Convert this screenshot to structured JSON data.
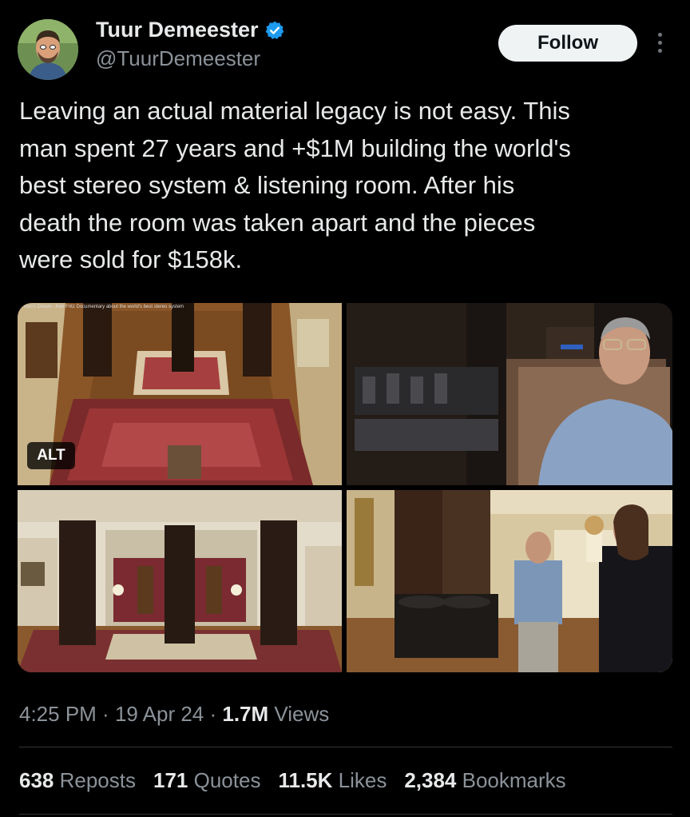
{
  "author": {
    "name": "Tuur Demeester",
    "handle": "@TuurDemeester",
    "follow_label": "Follow"
  },
  "tweet": {
    "text": "Leaving an actual material legacy is not easy. This\nman spent 27 years and +$1M building the world's\nbest stereo system & listening room. After his\ndeath the room was taken apart and the pieces\nwere sold for $158k."
  },
  "media": {
    "video_caption": "Ken's Dream - Ken Fritz Documentary about the world's best stereo system",
    "alt_label": "ALT"
  },
  "meta": {
    "time": "4:25 PM",
    "sep1": " · ",
    "date": "19 Apr 24",
    "sep2": " · ",
    "views_count": "1.7M",
    "views_label": " Views"
  },
  "stats": [
    {
      "count": "638",
      "label": " Reposts"
    },
    {
      "count": "171",
      "label": " Quotes"
    },
    {
      "count": "11.5K",
      "label": " Likes"
    },
    {
      "count": "2,384",
      "label": " Bookmarks"
    }
  ],
  "colors": {
    "background": "#000000",
    "text": "#e7e9ea",
    "secondary_text": "#8b9299",
    "verified": "#1d9bf0",
    "follow_bg": "#eff3f4"
  }
}
